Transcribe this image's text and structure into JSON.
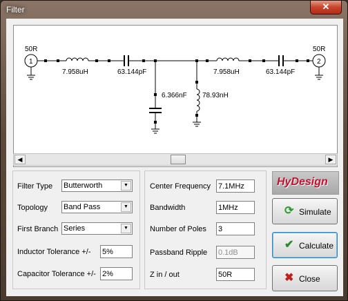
{
  "window": {
    "title": "Filter",
    "close_glyph": "✕"
  },
  "schematic": {
    "port1": {
      "number": "1",
      "label": "50R"
    },
    "port2": {
      "number": "2",
      "label": "50R"
    },
    "components": {
      "l1": "7.958uH",
      "c1": "63.144pF",
      "c_shunt": "6.366nF",
      "l_shunt": "78.93nH",
      "l2": "7.958uH",
      "c2": "63.144pF"
    }
  },
  "scrollbar": {
    "left_arrow": "◀",
    "right_arrow": "▶"
  },
  "left_group": {
    "filter_type": {
      "label": "Filter Type",
      "value": "Butterworth"
    },
    "topology": {
      "label": "Topology",
      "value": "Band Pass"
    },
    "first_branch": {
      "label": "First Branch",
      "value": "Series"
    },
    "inductor_tolerance": {
      "label": "Inductor Tolerance +/-",
      "value": "5%"
    },
    "capacitor_tolerance": {
      "label": "Capacitor Tolerance +/-",
      "value": "2%"
    },
    "dropdown_glyph": "▼"
  },
  "right_group": {
    "center_frequency": {
      "label": "Center Frequency",
      "value": "7.1MHz"
    },
    "bandwidth": {
      "label": "Bandwidth",
      "value": "1MHz"
    },
    "number_of_poles": {
      "label": "Number of Poles",
      "value": "3"
    },
    "passband_ripple": {
      "label": "Passband Ripple",
      "value": "0.1dB"
    },
    "z_in_out": {
      "label": "Z in / out",
      "value": "50R"
    }
  },
  "logo": {
    "text": "HyDesign"
  },
  "buttons": {
    "simulate": {
      "label": "Simulate",
      "icon": "refresh-icon",
      "glyph": "⟳",
      "color": "#2a9a2a"
    },
    "calculate": {
      "label": "Calculate",
      "icon": "checkmark-icon",
      "glyph": "✔",
      "color": "#2a8a2a"
    },
    "close": {
      "label": "Close",
      "icon": "close-x-icon",
      "glyph": "✖",
      "color": "#c0201a"
    }
  }
}
